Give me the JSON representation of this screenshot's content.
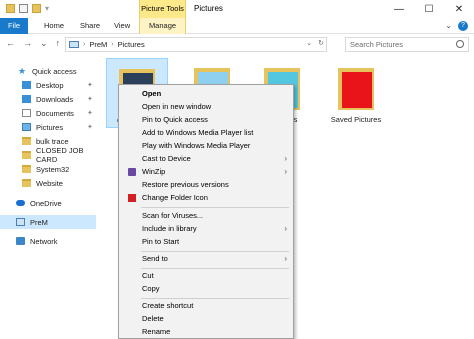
{
  "titlebar": {
    "contextual_tab": "Picture Tools",
    "title": "Pictures",
    "minimize": "—",
    "maximize": "☐",
    "close": "✕"
  },
  "ribbon": {
    "file": "File",
    "home": "Home",
    "share": "Share",
    "view": "View",
    "manage": "Manage",
    "expand": "⌄",
    "help": "?"
  },
  "nav": {
    "back": "←",
    "forward": "→",
    "recent": "⌄",
    "up": "↑"
  },
  "address": {
    "segment1": "PreM",
    "segment2": "Pictures",
    "dropdown": "⌄",
    "refresh": "↻"
  },
  "search": {
    "placeholder": "Search Pictures"
  },
  "sidebar": {
    "quick_access": "Quick access",
    "desktop": "Desktop",
    "downloads": "Downloads",
    "documents": "Documents",
    "pictures": "Pictures",
    "bulk_trace": "bulk trace",
    "closed_job_card": "CLOSED JOB CARD",
    "system32": "System32",
    "website": "Website",
    "onedrive": "OneDrive",
    "this_pc": "PreM",
    "network": "Network"
  },
  "items": {
    "selected_label_fragment": "C",
    "third_label_fragment": "ls",
    "saved_pictures": "Saved Pictures"
  },
  "menu": {
    "open": "Open",
    "open_new_window": "Open in new window",
    "pin_quick_access": "Pin to Quick access",
    "add_wmp_list": "Add to Windows Media Player list",
    "play_wmp": "Play with Windows Media Player",
    "cast_to_device": "Cast to Device",
    "winzip": "WinZip",
    "restore_versions": "Restore previous versions",
    "change_folder_icon": "Change Folder Icon",
    "scan_viruses": "Scan for Viruses...",
    "include_library": "Include in library",
    "pin_start": "Pin to Start",
    "send_to": "Send to",
    "cut": "Cut",
    "copy": "Copy",
    "create_shortcut": "Create shortcut",
    "delete": "Delete",
    "rename": "Rename",
    "submenu_arrow": "›"
  },
  "colors": {
    "accent": "#1979ca",
    "picture_tools": "#fde98a",
    "selection": "#cce8ff",
    "saved_pictures_red": "#e8141a"
  }
}
